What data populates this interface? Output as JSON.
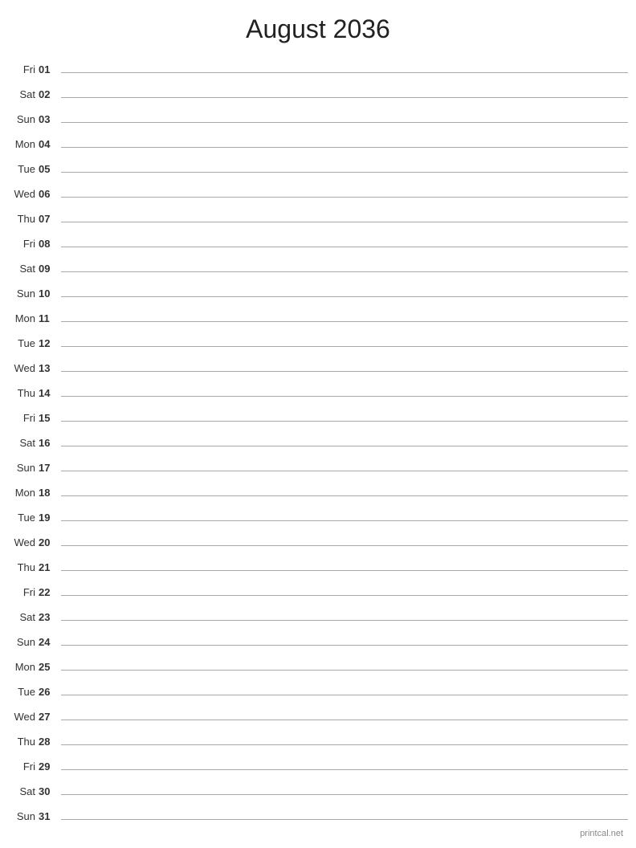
{
  "header": {
    "title": "August 2036"
  },
  "days": [
    {
      "name": "Fri",
      "num": "01"
    },
    {
      "name": "Sat",
      "num": "02"
    },
    {
      "name": "Sun",
      "num": "03"
    },
    {
      "name": "Mon",
      "num": "04"
    },
    {
      "name": "Tue",
      "num": "05"
    },
    {
      "name": "Wed",
      "num": "06"
    },
    {
      "name": "Thu",
      "num": "07"
    },
    {
      "name": "Fri",
      "num": "08"
    },
    {
      "name": "Sat",
      "num": "09"
    },
    {
      "name": "Sun",
      "num": "10"
    },
    {
      "name": "Mon",
      "num": "11"
    },
    {
      "name": "Tue",
      "num": "12"
    },
    {
      "name": "Wed",
      "num": "13"
    },
    {
      "name": "Thu",
      "num": "14"
    },
    {
      "name": "Fri",
      "num": "15"
    },
    {
      "name": "Sat",
      "num": "16"
    },
    {
      "name": "Sun",
      "num": "17"
    },
    {
      "name": "Mon",
      "num": "18"
    },
    {
      "name": "Tue",
      "num": "19"
    },
    {
      "name": "Wed",
      "num": "20"
    },
    {
      "name": "Thu",
      "num": "21"
    },
    {
      "name": "Fri",
      "num": "22"
    },
    {
      "name": "Sat",
      "num": "23"
    },
    {
      "name": "Sun",
      "num": "24"
    },
    {
      "name": "Mon",
      "num": "25"
    },
    {
      "name": "Tue",
      "num": "26"
    },
    {
      "name": "Wed",
      "num": "27"
    },
    {
      "name": "Thu",
      "num": "28"
    },
    {
      "name": "Fri",
      "num": "29"
    },
    {
      "name": "Sat",
      "num": "30"
    },
    {
      "name": "Sun",
      "num": "31"
    }
  ],
  "footer": {
    "text": "printcal.net"
  }
}
